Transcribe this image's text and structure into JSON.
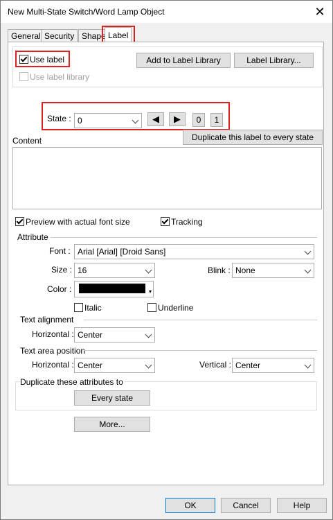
{
  "window": {
    "title": "New Multi-State Switch/Word Lamp Object",
    "close_icon": "close-icon"
  },
  "tabs": [
    {
      "label": "General"
    },
    {
      "label": "Security"
    },
    {
      "label": "Shape"
    },
    {
      "label": "Label",
      "active": true
    }
  ],
  "label_options": {
    "use_label": "Use label",
    "use_label_checked": true,
    "use_label_library": "Use label library",
    "use_label_library_enabled": false,
    "add_to_library": "Add to Label Library",
    "label_library": "Label Library..."
  },
  "state": {
    "label": "State :",
    "value": "0",
    "btn_first": "0",
    "btn_second": "1"
  },
  "content": {
    "label": "Content",
    "duplicate_button": "Duplicate this label to every state",
    "text": ""
  },
  "preview": {
    "label": "Preview with actual font size",
    "checked": true
  },
  "tracking": {
    "label": "Tracking",
    "checked": true
  },
  "attribute": {
    "heading": "Attribute",
    "font_label": "Font :",
    "font_value": "Arial [Arial] [Droid Sans]",
    "size_label": "Size :",
    "size_value": "16",
    "blink_label": "Blink :",
    "blink_value": "None",
    "color_label": "Color :",
    "color_value": "#000000",
    "italic": "Italic",
    "underline": "Underline"
  },
  "text_alignment": {
    "heading": "Text alignment",
    "horizontal_label": "Horizontal :",
    "horizontal_value": "Center"
  },
  "text_area_position": {
    "heading": "Text area position",
    "horizontal_label": "Horizontal :",
    "horizontal_value": "Center",
    "vertical_label": "Vertical :",
    "vertical_value": "Center"
  },
  "duplicate_attrs": {
    "heading": "Duplicate these attributes to",
    "every_state": "Every state"
  },
  "more_button": "More...",
  "footer": {
    "ok": "OK",
    "cancel": "Cancel",
    "help": "Help"
  },
  "highlight_color": "#e02020"
}
